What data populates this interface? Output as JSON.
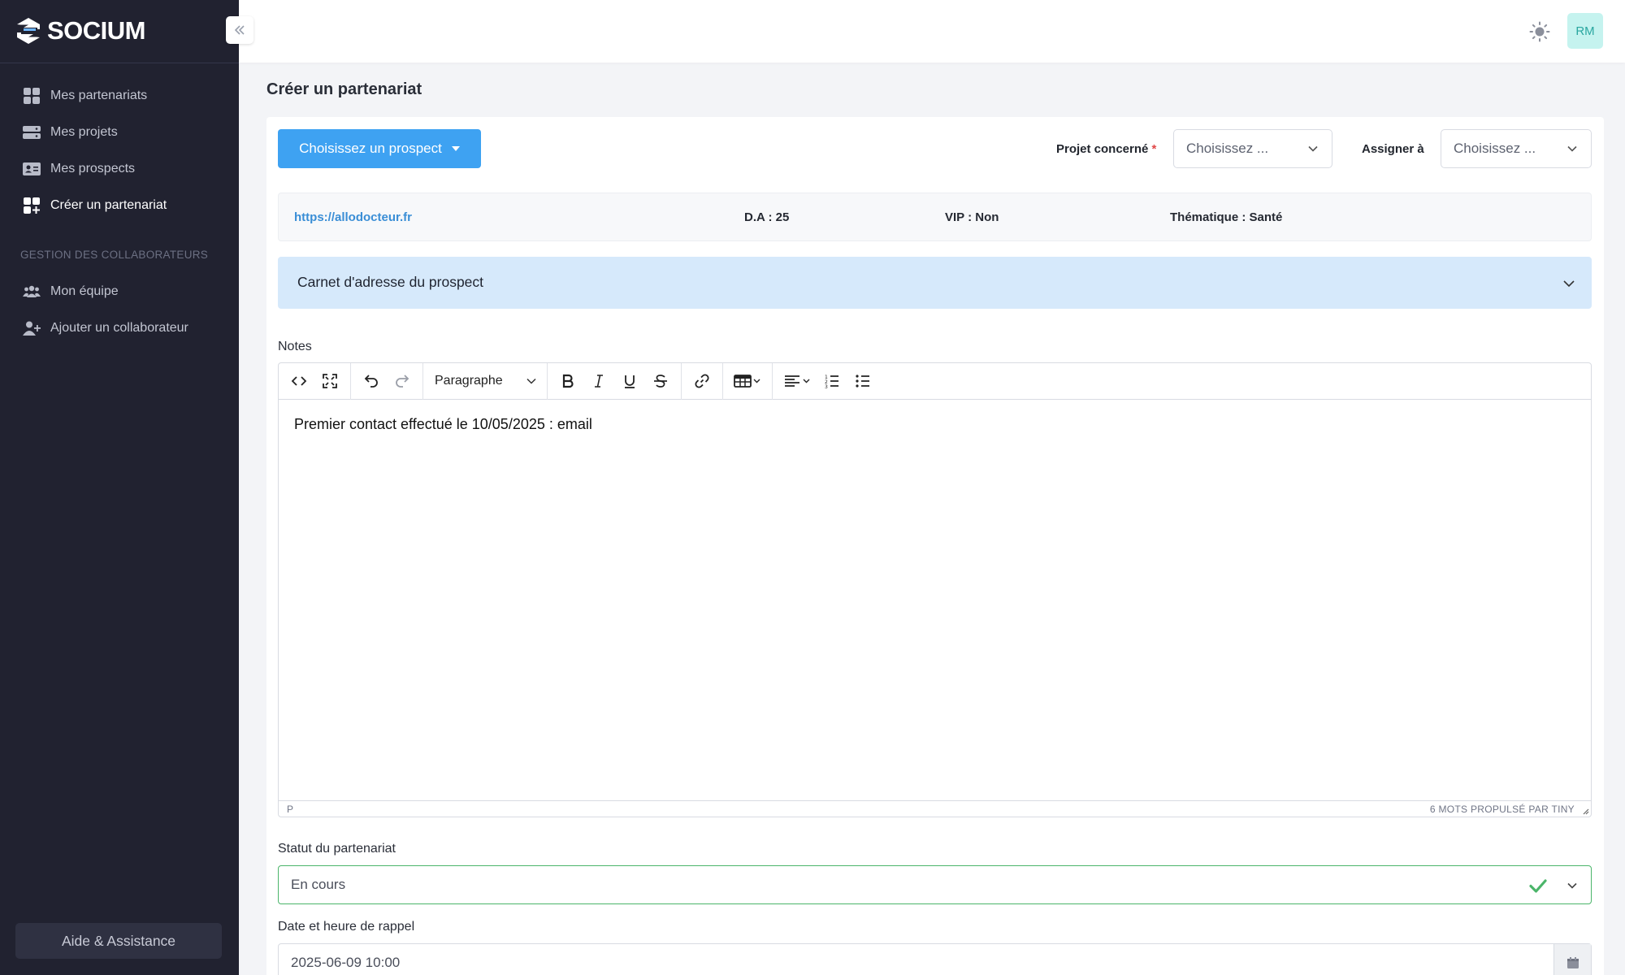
{
  "app": {
    "brand": "SOCIUM",
    "avatar_initials": "RM"
  },
  "sidebar": {
    "items": [
      {
        "label": "Mes partenariats",
        "icon": "grid-icon",
        "active": false
      },
      {
        "label": "Mes projets",
        "icon": "server-icon",
        "active": false
      },
      {
        "label": "Mes prospects",
        "icon": "id-card-icon",
        "active": false
      },
      {
        "label": "Créer un partenariat",
        "icon": "grid-plus-icon",
        "active": true
      }
    ],
    "section_title": "GESTION DES COLLABORATEURS",
    "team_items": [
      {
        "label": "Mon équipe",
        "icon": "users-icon"
      },
      {
        "label": "Ajouter un collaborateur",
        "icon": "user-plus-icon"
      }
    ],
    "help_label": "Aide & Assistance"
  },
  "page": {
    "title": "Créer un partenariat"
  },
  "form": {
    "prospect_button": "Choisissez un prospect",
    "project_label": "Projet concerné",
    "project_required_mark": "*",
    "project_placeholder": "Choisissez ...",
    "assign_label": "Assigner à",
    "assign_placeholder": "Choisissez ...",
    "info": {
      "url": "https://allodocteur.fr",
      "da": "D.A : 25",
      "vip": "VIP : Non",
      "theme": "Thématique : Santé"
    },
    "address_book_title": "Carnet d'adresse du prospect",
    "notes_label": "Notes",
    "editor": {
      "block_format": "Paragraphe",
      "content": "Premier contact effectué le 10/05/2025 : email",
      "path": "P",
      "status": "6 MOTS  PROPULSÉ PAR TINY"
    },
    "status_label": "Statut du partenariat",
    "status_value": "En cours",
    "reminder_label": "Date et heure de rappel",
    "reminder_value": "2025-06-09 10:00"
  },
  "colors": {
    "sidebar_bg": "#212230",
    "primary_button": "#3ea2f2",
    "accordion_bg": "#d6e9fb",
    "success": "#4bb56a",
    "avatar_bg": "#c5f3ef"
  }
}
